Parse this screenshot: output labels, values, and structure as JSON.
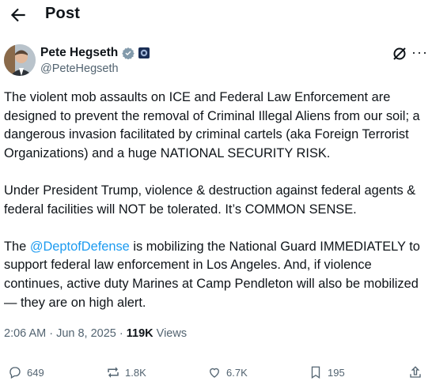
{
  "header": {
    "title": "Post"
  },
  "author": {
    "name": "Pete Hegseth",
    "handle": "@PeteHegseth"
  },
  "post": {
    "p1": "The violent mob assaults on ICE and Federal Law Enforcement are designed to prevent the removal of Criminal Illegal Aliens from our soil; a dangerous invasion facilitated by criminal cartels (aka Foreign Terrorist Organizations) and a huge NATIONAL SECURITY RISK.",
    "p2": "Under President Trump, violence & destruction against federal agents & federal facilities will NOT be tolerated. It’s COMMON SENSE.",
    "p3_pre": "The ",
    "p3_mention": "@DeptofDefense",
    "p3_post": " is mobilizing the National Guard IMMEDIATELY to support federal law enforcement in Los Angeles. And, if violence continues, active duty Marines at Camp Pendleton will also be mobilized — they are on high alert."
  },
  "meta": {
    "timestamp": "2:06 AM · Jun 8, 2025 · ",
    "views_count": "119K",
    "views_label": " Views"
  },
  "actions": {
    "replies": "649",
    "reposts": "1.8K",
    "likes": "6.7K",
    "bookmarks": "195"
  },
  "icons": {
    "back": "arrow-left-icon",
    "verified": "verified-badge-icon",
    "affiliate": "affiliate-badge-icon",
    "grok": "grok-icon",
    "more": "more-icon",
    "reply": "reply-icon",
    "repost": "repost-icon",
    "like": "heart-icon",
    "bookmark": "bookmark-icon",
    "share": "share-icon"
  },
  "colors": {
    "link": "#1d9bf0",
    "secondary": "#536471",
    "text": "#0f1419"
  }
}
